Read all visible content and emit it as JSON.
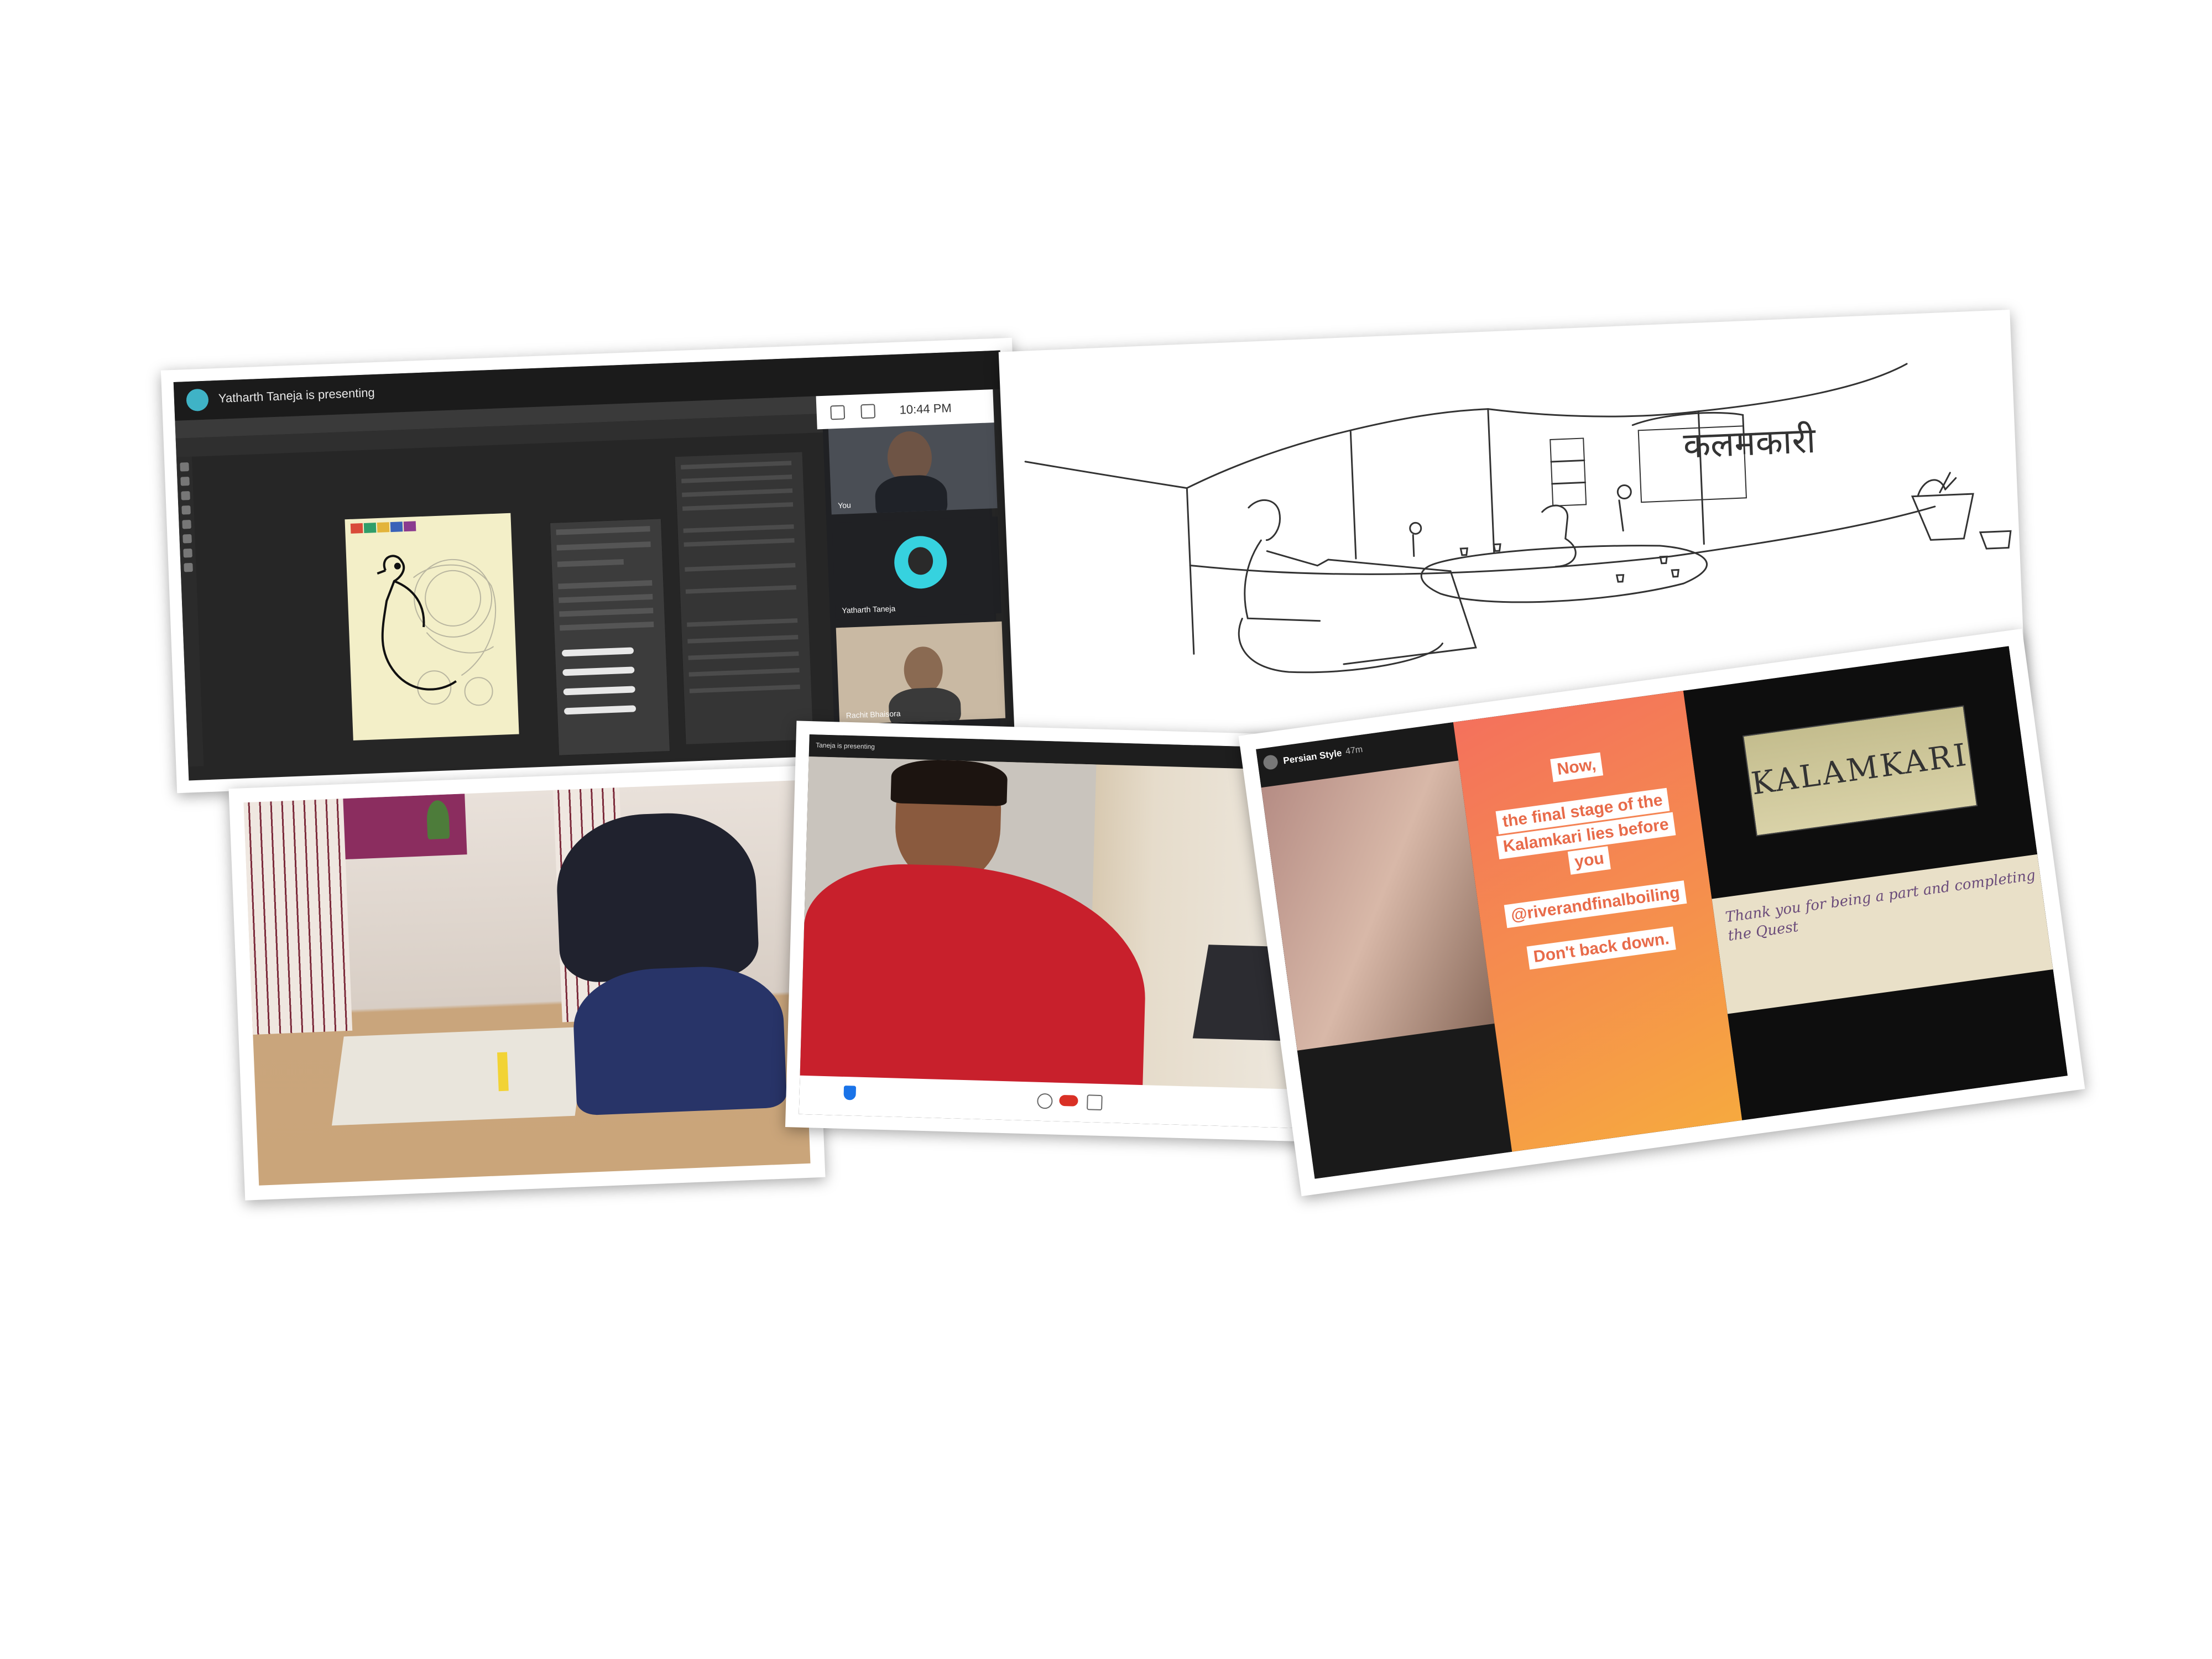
{
  "photo1": {
    "presenter_banner": "Yatharth Taneja is presenting",
    "meet_clock": "10:44 PM",
    "tiles": [
      {
        "label": "You"
      },
      {
        "label": "Yatharth Taneja"
      },
      {
        "label": "Rachit Bhaisora"
      }
    ],
    "swatch_colors": [
      "#d94b3a",
      "#2f9e6a",
      "#e3b43b",
      "#3a62b8",
      "#8a3b8f"
    ]
  },
  "photo2": {
    "devanagari_title": "कलमकारी"
  },
  "photo4": {
    "presenter_banner": "Taneja is presenting"
  },
  "photo5": {
    "story_header": "Persian Style",
    "story_age": "47m",
    "pills": [
      "Now,",
      "the final stage of the",
      "Kalamkari lies before",
      "you",
      "@riverandfinalboiling",
      "Don't back down."
    ],
    "cloth_text": "KALAMKARI",
    "thanks_text": "Thank you for being a part and completing the Quest"
  }
}
